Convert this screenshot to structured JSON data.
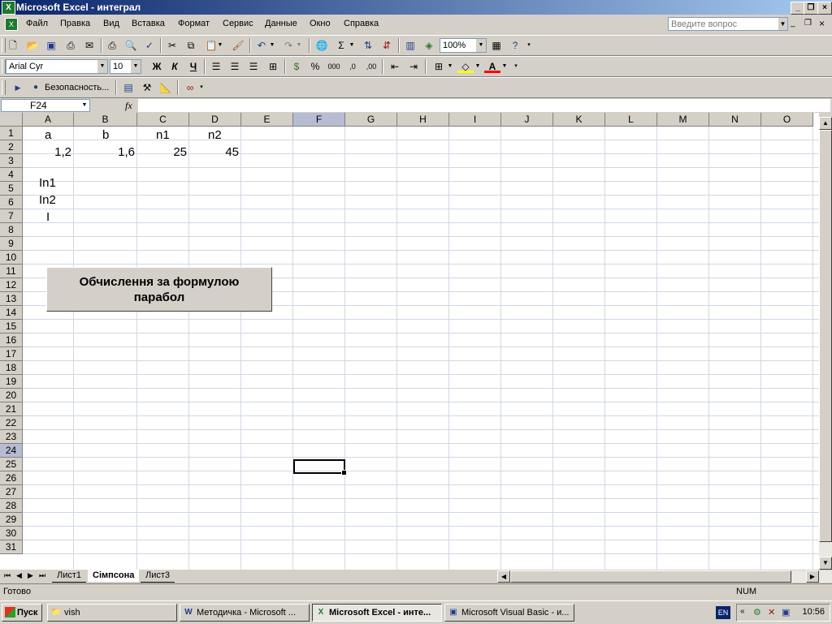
{
  "window": {
    "title": "Microsoft Excel - интеграл"
  },
  "menu": {
    "items": [
      {
        "label": "Файл"
      },
      {
        "label": "Правка"
      },
      {
        "label": "Вид"
      },
      {
        "label": "Вставка"
      },
      {
        "label": "Формат"
      },
      {
        "label": "Сервис"
      },
      {
        "label": "Данные"
      },
      {
        "label": "Окно"
      },
      {
        "label": "Справка"
      }
    ],
    "help_placeholder": "Введите вопрос"
  },
  "toolbar": {
    "zoom": "100%",
    "font_name": "Arial Cyr",
    "font_size": "10",
    "bold": "Ж",
    "italic": "К",
    "underline": "Ч",
    "security_label": "Безопасность...",
    "percent": "%",
    "thousands": "000"
  },
  "formula_bar": {
    "name_box": "F24",
    "fx": "fx",
    "formula": ""
  },
  "grid": {
    "columns": [
      "A",
      "B",
      "C",
      "D",
      "E",
      "F",
      "G",
      "H",
      "I",
      "J",
      "K",
      "L",
      "M",
      "N",
      "O"
    ],
    "rows": [
      "1",
      "2",
      "3",
      "4",
      "5",
      "6",
      "7",
      "8",
      "9",
      "10",
      "11",
      "12",
      "13",
      "14",
      "15",
      "16",
      "17",
      "18",
      "19",
      "20",
      "21",
      "22",
      "23",
      "24",
      "25",
      "26",
      "27",
      "28",
      "29",
      "30",
      "31"
    ],
    "selected_column": "F",
    "selected_row": "24",
    "cells": {
      "A1": "a",
      "B1": "b",
      "C1": "n1",
      "D1": "n2",
      "A2": "1,2",
      "B2": "1,6",
      "C2": "25",
      "D2": "45",
      "A4": "In1",
      "A5": "In2",
      "A6": "I"
    },
    "button_label_line1": "Обчислення за формулою",
    "button_label_line2": "парабол"
  },
  "sheets": {
    "tabs": [
      "Лист1",
      "Сімпсона",
      "Лист3"
    ],
    "active": "Сімпсона"
  },
  "status": {
    "text": "Готово",
    "num": "NUM"
  },
  "taskbar": {
    "start": "Пуск",
    "tasks": [
      "vish",
      "Методичка - Microsoft ...",
      "Microsoft Excel - инте...",
      "Microsoft Visual Basic - и..."
    ],
    "lang": "EN",
    "clock": "10:56"
  }
}
